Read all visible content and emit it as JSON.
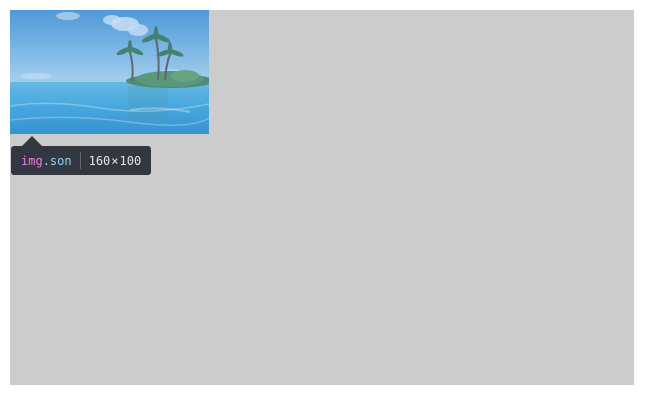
{
  "inspector_tooltip": {
    "tag": "img",
    "class": ".son",
    "width": "160",
    "times": "×",
    "height": "100"
  },
  "colors": {
    "stage_background": "#cccccc",
    "tooltip_background": "#333740",
    "highlight_overlay": "#6fa8dc",
    "tag_color": "#ee78e6",
    "class_color": "#8ed7f5",
    "dims_color": "#e6e6e6"
  },
  "image": {
    "icon": "tropical-island-photo"
  }
}
